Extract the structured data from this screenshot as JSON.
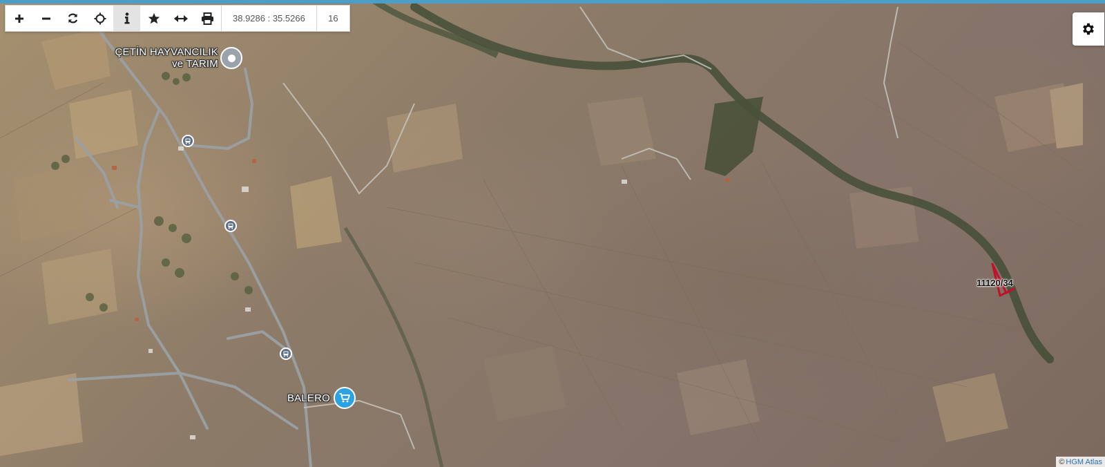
{
  "toolbar": {
    "buttons": [
      {
        "name": "zoom-in-button",
        "icon": "plus-icon"
      },
      {
        "name": "zoom-out-button",
        "icon": "minus-icon"
      },
      {
        "name": "refresh-button",
        "icon": "refresh-icon"
      },
      {
        "name": "locate-button",
        "icon": "crosshair-icon"
      },
      {
        "name": "info-button",
        "icon": "info-icon",
        "active": true
      },
      {
        "name": "favorite-button",
        "icon": "star-icon"
      },
      {
        "name": "measure-button",
        "icon": "arrows-horizontal-icon"
      },
      {
        "name": "print-button",
        "icon": "printer-icon"
      }
    ],
    "coordinates": "38.9286 : 35.5266",
    "zoom_level": "16"
  },
  "map": {
    "type": "satellite",
    "pois": [
      {
        "name": "poi-cetin-hayvancilik",
        "line1": "ÇETİN HAYVANCILIK",
        "line2": "ve TARIM",
        "icon": "location-pin-icon",
        "color": "#9aa3ab"
      },
      {
        "name": "poi-balero",
        "line1": "BALERO",
        "line2": "",
        "icon": "shopping-cart-icon",
        "color": "#2aa3e0"
      }
    ],
    "bus_stop_icon": "bus-icon",
    "parcel": {
      "label": "11120/34",
      "color": "#c0102a"
    }
  },
  "settings": {
    "icon": "gear-icon"
  },
  "attribution": {
    "prefix": "©",
    "text": "HGM Atlas"
  }
}
